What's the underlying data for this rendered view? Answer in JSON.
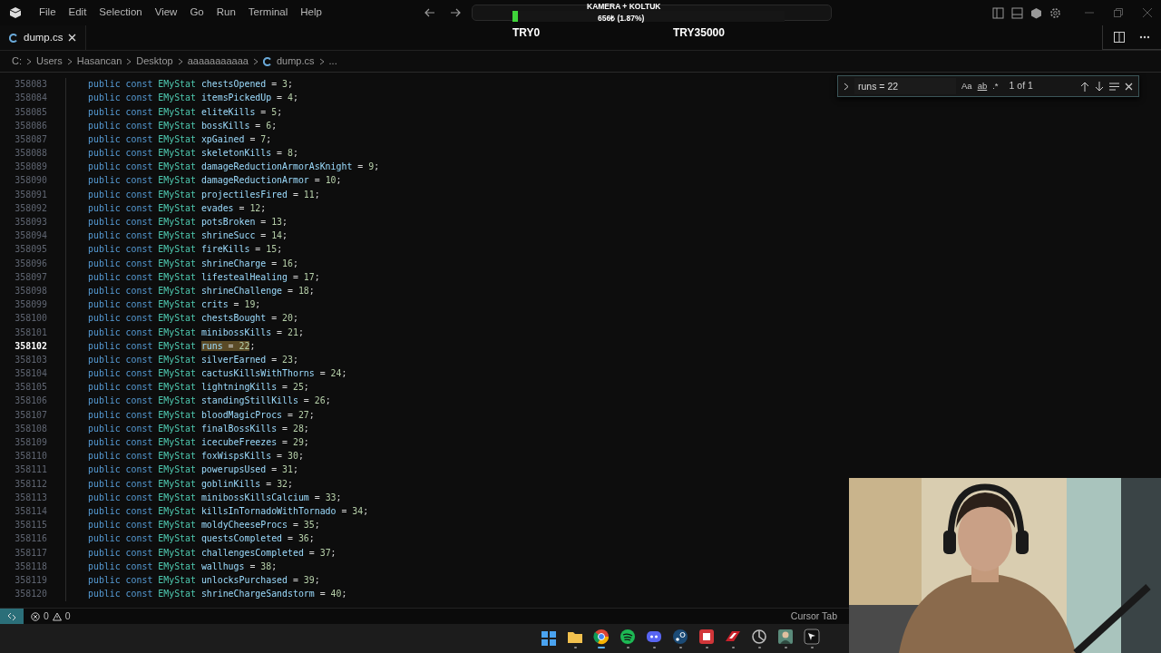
{
  "title_bar": {
    "menu": [
      "File",
      "Edit",
      "Selection",
      "View",
      "Go",
      "Run",
      "Terminal",
      "Help"
    ]
  },
  "overlay": {
    "title": "KAMERA + KOLTUK",
    "amount": "656₺ (1.87%)",
    "level": 0.0187,
    "start": "TRY0",
    "end": "TRY35000"
  },
  "tabs": [
    {
      "label": "dump.cs",
      "selected": true
    }
  ],
  "breadcrumbs": [
    "C:",
    "Users",
    "Hasancan",
    "Desktop",
    "aaaaaaaaaaa",
    "dump.cs",
    "..."
  ],
  "editor": {
    "lines": [
      {
        "number": "358083",
        "keywords": "public const",
        "type": "EMyStat",
        "name": "chestsOpened",
        "op": "=",
        "value": "3",
        "end": ";",
        "highlighted": false
      },
      {
        "number": "358084",
        "keywords": "public const",
        "type": "EMyStat",
        "name": "itemsPickedUp",
        "op": "=",
        "value": "4",
        "end": ";",
        "highlighted": false
      },
      {
        "number": "358085",
        "keywords": "public const",
        "type": "EMyStat",
        "name": "eliteKills",
        "op": "=",
        "value": "5",
        "end": ";",
        "highlighted": false
      },
      {
        "number": "358086",
        "keywords": "public const",
        "type": "EMyStat",
        "name": "bossKills",
        "op": "=",
        "value": "6",
        "end": ";",
        "highlighted": false
      },
      {
        "number": "358087",
        "keywords": "public const",
        "type": "EMyStat",
        "name": "xpGained",
        "op": "=",
        "value": "7",
        "end": ";",
        "highlighted": false
      },
      {
        "number": "358088",
        "keywords": "public const",
        "type": "EMyStat",
        "name": "skeletonKills",
        "op": "=",
        "value": "8",
        "end": ";",
        "highlighted": false
      },
      {
        "number": "358089",
        "keywords": "public const",
        "type": "EMyStat",
        "name": "damageReductionArmorAsKnight",
        "op": "=",
        "value": "9",
        "end": ";",
        "highlighted": false
      },
      {
        "number": "358090",
        "keywords": "public const",
        "type": "EMyStat",
        "name": "damageReductionArmor",
        "op": "=",
        "value": "10",
        "end": ";",
        "highlighted": false
      },
      {
        "number": "358091",
        "keywords": "public const",
        "type": "EMyStat",
        "name": "projectilesFired",
        "op": "=",
        "value": "11",
        "end": ";",
        "highlighted": false
      },
      {
        "number": "358092",
        "keywords": "public const",
        "type": "EMyStat",
        "name": "evades",
        "op": "=",
        "value": "12",
        "end": ";",
        "highlighted": false
      },
      {
        "number": "358093",
        "keywords": "public const",
        "type": "EMyStat",
        "name": "potsBroken",
        "op": "=",
        "value": "13",
        "end": ";",
        "highlighted": false
      },
      {
        "number": "358094",
        "keywords": "public const",
        "type": "EMyStat",
        "name": "shrineSucc",
        "op": "=",
        "value": "14",
        "end": ";",
        "highlighted": false
      },
      {
        "number": "358095",
        "keywords": "public const",
        "type": "EMyStat",
        "name": "fireKills",
        "op": "=",
        "value": "15",
        "end": ";",
        "highlighted": false
      },
      {
        "number": "358096",
        "keywords": "public const",
        "type": "EMyStat",
        "name": "shrineCharge",
        "op": "=",
        "value": "16",
        "end": ";",
        "highlighted": false
      },
      {
        "number": "358097",
        "keywords": "public const",
        "type": "EMyStat",
        "name": "lifestealHealing",
        "op": "=",
        "value": "17",
        "end": ";",
        "highlighted": false
      },
      {
        "number": "358098",
        "keywords": "public const",
        "type": "EMyStat",
        "name": "shrineChallenge",
        "op": "=",
        "value": "18",
        "end": ";",
        "highlighted": false
      },
      {
        "number": "358099",
        "keywords": "public const",
        "type": "EMyStat",
        "name": "crits",
        "op": "=",
        "value": "19",
        "end": ";",
        "highlighted": false
      },
      {
        "number": "358100",
        "keywords": "public const",
        "type": "EMyStat",
        "name": "chestsBought",
        "op": "=",
        "value": "20",
        "end": ";",
        "highlighted": false
      },
      {
        "number": "358101",
        "keywords": "public const",
        "type": "EMyStat",
        "name": "minibossKills",
        "op": "=",
        "value": "21",
        "end": ";",
        "highlighted": false
      },
      {
        "number": "358102",
        "keywords": "public const",
        "type": "EMyStat",
        "name": "runs",
        "op": "=",
        "value": "22",
        "end": ";",
        "highlighted": true
      },
      {
        "number": "358103",
        "keywords": "public const",
        "type": "EMyStat",
        "name": "silverEarned",
        "op": "=",
        "value": "23",
        "end": ";",
        "highlighted": false
      },
      {
        "number": "358104",
        "keywords": "public const",
        "type": "EMyStat",
        "name": "cactusKillsWithThorns",
        "op": "=",
        "value": "24",
        "end": ";",
        "highlighted": false
      },
      {
        "number": "358105",
        "keywords": "public const",
        "type": "EMyStat",
        "name": "lightningKills",
        "op": "=",
        "value": "25",
        "end": ";",
        "highlighted": false
      },
      {
        "number": "358106",
        "keywords": "public const",
        "type": "EMyStat",
        "name": "standingStillKills",
        "op": "=",
        "value": "26",
        "end": ";",
        "highlighted": false
      },
      {
        "number": "358107",
        "keywords": "public const",
        "type": "EMyStat",
        "name": "bloodMagicProcs",
        "op": "=",
        "value": "27",
        "end": ";",
        "highlighted": false
      },
      {
        "number": "358108",
        "keywords": "public const",
        "type": "EMyStat",
        "name": "finalBossKills",
        "op": "=",
        "value": "28",
        "end": ";",
        "highlighted": false
      },
      {
        "number": "358109",
        "keywords": "public const",
        "type": "EMyStat",
        "name": "icecubeFreezes",
        "op": "=",
        "value": "29",
        "end": ";",
        "highlighted": false
      },
      {
        "number": "358110",
        "keywords": "public const",
        "type": "EMyStat",
        "name": "foxWispsKills",
        "op": "=",
        "value": "30",
        "end": ";",
        "highlighted": false
      },
      {
        "number": "358111",
        "keywords": "public const",
        "type": "EMyStat",
        "name": "powerupsUsed",
        "op": "=",
        "value": "31",
        "end": ";",
        "highlighted": false
      },
      {
        "number": "358112",
        "keywords": "public const",
        "type": "EMyStat",
        "name": "goblinKills",
        "op": "=",
        "value": "32",
        "end": ";",
        "highlighted": false
      },
      {
        "number": "358113",
        "keywords": "public const",
        "type": "EMyStat",
        "name": "minibossKillsCalcium",
        "op": "=",
        "value": "33",
        "end": ";",
        "highlighted": false
      },
      {
        "number": "358114",
        "keywords": "public const",
        "type": "EMyStat",
        "name": "killsInTornadoWithTornado",
        "op": "=",
        "value": "34",
        "end": ";",
        "highlighted": false
      },
      {
        "number": "358115",
        "keywords": "public const",
        "type": "EMyStat",
        "name": "moldyCheeseProcs",
        "op": "=",
        "value": "35",
        "end": ";",
        "highlighted": false
      },
      {
        "number": "358116",
        "keywords": "public const",
        "type": "EMyStat",
        "name": "questsCompleted",
        "op": "=",
        "value": "36",
        "end": ";",
        "highlighted": false
      },
      {
        "number": "358117",
        "keywords": "public const",
        "type": "EMyStat",
        "name": "challengesCompleted",
        "op": "=",
        "value": "37",
        "end": ";",
        "highlighted": false
      },
      {
        "number": "358118",
        "keywords": "public const",
        "type": "EMyStat",
        "name": "wallhugs",
        "op": "=",
        "value": "38",
        "end": ";",
        "highlighted": false
      },
      {
        "number": "358119",
        "keywords": "public const",
        "type": "EMyStat",
        "name": "unlocksPurchased",
        "op": "=",
        "value": "39",
        "end": ";",
        "highlighted": false
      },
      {
        "number": "358120",
        "keywords": "public const",
        "type": "EMyStat",
        "name": "shrineChargeSandstorm",
        "op": "=",
        "value": "40",
        "end": ";",
        "highlighted": false
      }
    ]
  },
  "find_widget": {
    "query": "runs = 22",
    "options": [
      "Aa",
      "ab",
      ".*"
    ],
    "count": "1 of 1"
  },
  "status_bar": {
    "errors": "0",
    "warnings": "0",
    "right": "Cursor Tab"
  },
  "taskbar": {
    "apps": [
      {
        "kind": "start"
      },
      {
        "kind": "folder",
        "selected": false
      },
      {
        "kind": "browser",
        "selected": true
      },
      {
        "kind": "music",
        "selected": false
      },
      {
        "kind": "chat",
        "selected": false
      },
      {
        "kind": "steam",
        "selected": false
      },
      {
        "kind": "game",
        "selected": false
      },
      {
        "kind": "racing",
        "selected": false
      },
      {
        "kind": "circle",
        "selected": false
      },
      {
        "kind": "avatar",
        "selected": false
      },
      {
        "kind": "cursor",
        "selected": false
      }
    ]
  },
  "webcam": {
    "kind": "picture"
  }
}
